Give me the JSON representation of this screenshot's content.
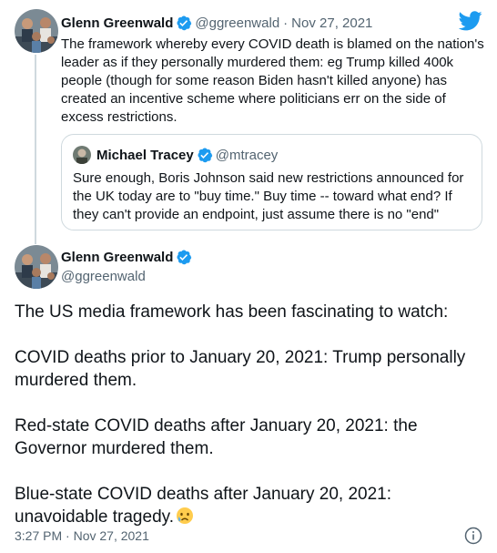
{
  "parent_tweet": {
    "author_name": "Glenn Greenwald",
    "handle": "@ggreenwald",
    "separator": "·",
    "date": "Nov 27, 2021",
    "text": "The framework whereby every COVID death is blamed on the nation's\nleader as if they personally murdered them: eg Trump killed 400k\npeople (though for some reason Biden hasn't killed anyone) has\ncreated an incentive scheme where politicians err on the side of\nexcess restrictions."
  },
  "quoted_tweet": {
    "author_name": "Michael Tracey",
    "handle": "@mtracey",
    "text": "Sure enough, Boris Johnson said new restrictions announced for\nthe UK today are to \"buy time.\" Buy time -- toward what end? If\nthey can't provide an endpoint, just assume there is no \"end\""
  },
  "main_tweet": {
    "author_name": "Glenn Greenwald",
    "handle": "@ggreenwald",
    "paragraphs": [
      "The US media framework has been fascinating to watch:",
      "COVID deaths prior to January 20, 2021: Trump personally murdered them.",
      "Red-state COVID deaths after January 20, 2021: the Governor murdered them.",
      "Blue-state COVID deaths after January 20, 2021: unavoidable tragedy."
    ],
    "emoji": "crying-face",
    "timestamp": "3:27 PM · Nov 27, 2021"
  },
  "icons": {
    "brand": "twitter-bird-icon",
    "verified": "verified-badge-icon",
    "info": "info-icon"
  },
  "colors": {
    "twitter_blue": "#1d9bf0",
    "text_primary": "#0f1419",
    "text_secondary": "#536471",
    "border": "#cfd9de"
  }
}
